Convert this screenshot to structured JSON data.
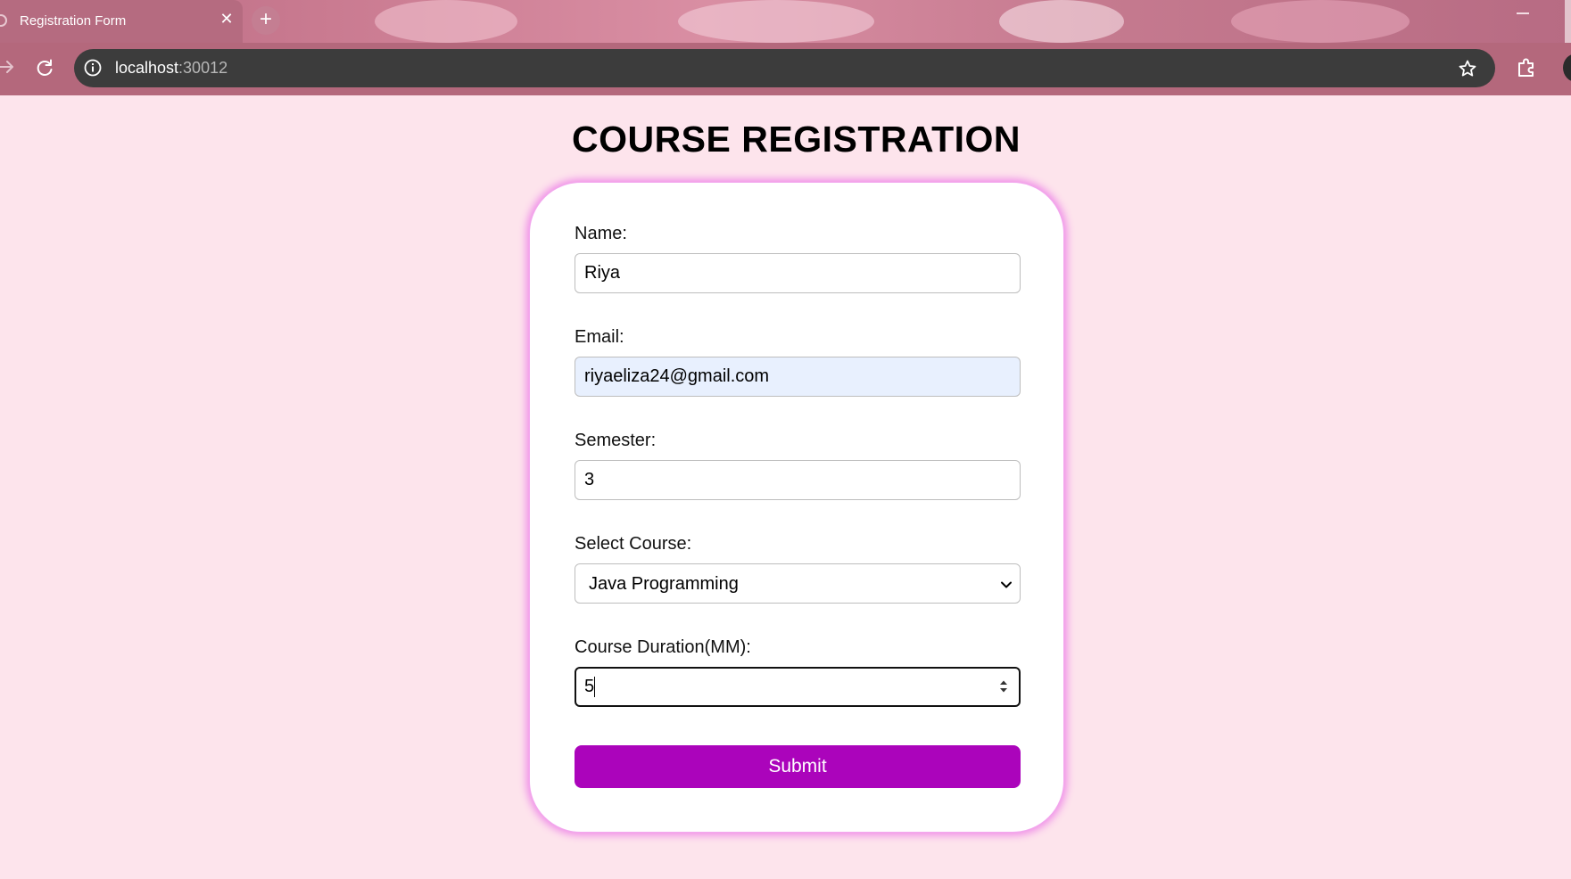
{
  "browser": {
    "tab_title": "Registration Form",
    "url_host": "localhost",
    "url_port": ":30012",
    "theme_color": "#b4687c",
    "omnibox_color": "#3c3c3c"
  },
  "page": {
    "title": "COURSE REGISTRATION",
    "background_color": "#fde4ec"
  },
  "form": {
    "name": {
      "label": "Name:",
      "value": "Riya"
    },
    "email": {
      "label": "Email:",
      "value": "riyaeliza24@gmail.com"
    },
    "semester": {
      "label": "Semester:",
      "value": "3"
    },
    "course": {
      "label": "Select Course:",
      "selected": "Java Programming"
    },
    "duration": {
      "label": "Course Duration(MM):",
      "value": "5"
    },
    "submit_label": "Submit",
    "submit_color": "#ab04bb",
    "card_glow_color": "#ef8ce8"
  }
}
